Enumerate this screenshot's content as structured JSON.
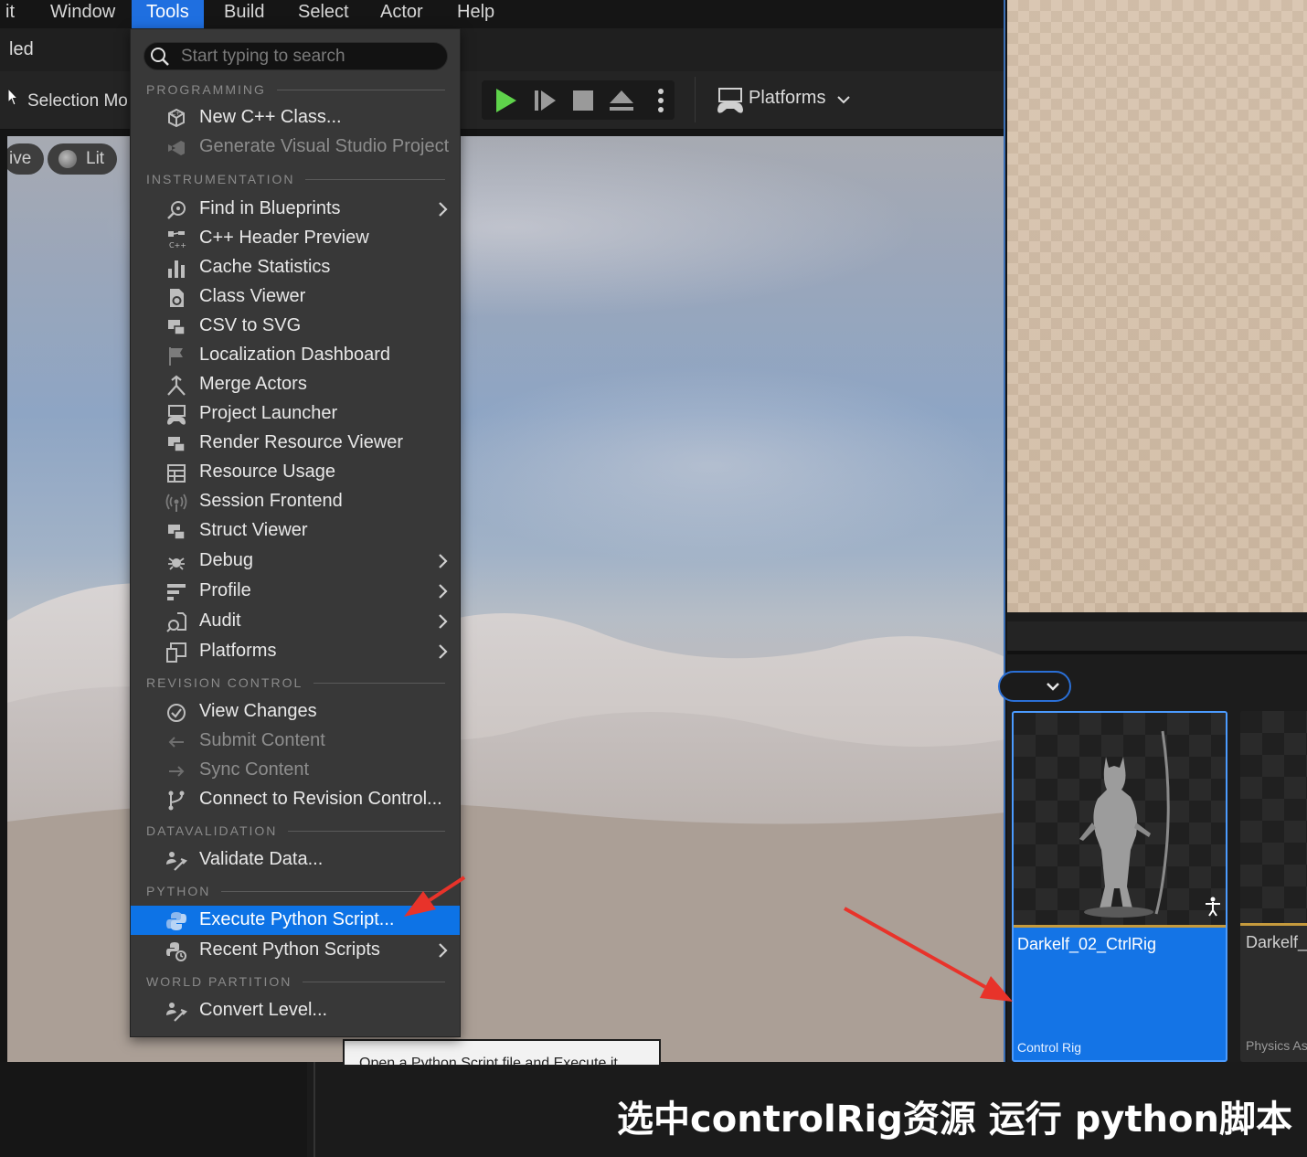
{
  "menubar": {
    "items": [
      {
        "label": "it"
      },
      {
        "label": "Window"
      },
      {
        "label": "Tools"
      },
      {
        "label": "Build"
      },
      {
        "label": "Select"
      },
      {
        "label": "Actor"
      },
      {
        "label": "Help"
      }
    ]
  },
  "subheader": {
    "title": "led"
  },
  "toolbar": {
    "selection_mode": "Selection Mo",
    "platforms": "Platforms"
  },
  "viewport": {
    "live": "ive",
    "lit": "Lit"
  },
  "tools_menu": {
    "search_placeholder": "Start typing to search",
    "sections": {
      "programming": "PROGRAMMING",
      "instrumentation": "INSTRUMENTATION",
      "revision_control": "REVISION CONTROL",
      "datavalidation": "DATAVALIDATION",
      "python": "PYTHON",
      "world_partition": "WORLD PARTITION"
    },
    "items": {
      "new_cpp_class": "New C++ Class...",
      "generate_vs": "Generate Visual Studio Project",
      "find_in_blueprints": "Find in Blueprints",
      "cpp_header_preview": "C++ Header Preview",
      "cache_statistics": "Cache Statistics",
      "class_viewer": "Class Viewer",
      "csv_to_svg": "CSV to SVG",
      "localization_dashboard": "Localization Dashboard",
      "merge_actors": "Merge Actors",
      "project_launcher": "Project Launcher",
      "render_resource_viewer": "Render Resource Viewer",
      "resource_usage": "Resource Usage",
      "session_frontend": "Session Frontend",
      "struct_viewer": "Struct Viewer",
      "debug": "Debug",
      "profile": "Profile",
      "audit": "Audit",
      "platforms": "Platforms",
      "view_changes": "View Changes",
      "submit_content": "Submit Content",
      "sync_content": "Sync Content",
      "connect_revision": "Connect to Revision Control...",
      "validate_data": "Validate Data...",
      "execute_python": "Execute Python Script...",
      "recent_python": "Recent Python Scripts",
      "convert_level": "Convert Level..."
    }
  },
  "tooltip": {
    "text": "Open a Python Script file and Execute it."
  },
  "assets": [
    {
      "name": "Darkelf_02_CtrlRig",
      "type": "Control Rig"
    },
    {
      "name": "Darkelf_(",
      "type": "Physics As"
    }
  ],
  "caption": "选中controlRig资源 运行 python脚本",
  "colors": {
    "highlight": "#0d73e6",
    "active_menu": "#1f6fe0",
    "arrow": "#e8332a",
    "play": "#5fd34b"
  }
}
